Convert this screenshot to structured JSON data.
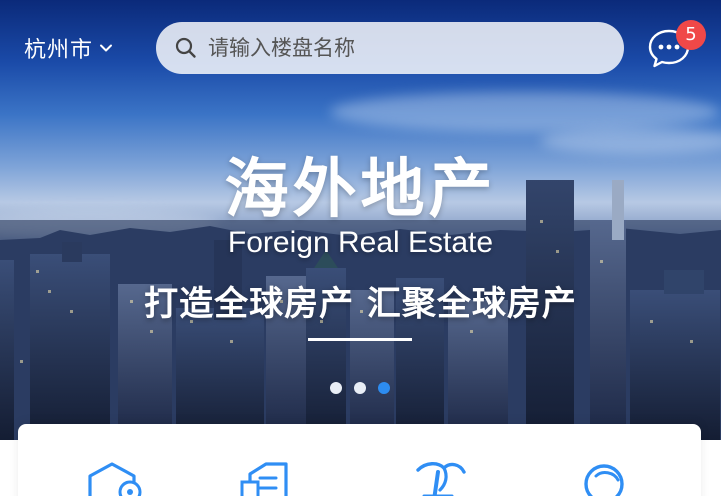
{
  "header": {
    "city": "杭州市",
    "search_placeholder": "请输入楼盘名称",
    "message_count": "5"
  },
  "banner": {
    "title": "海外地产",
    "subtitle_en": "Foreign Real Estate",
    "slogan": "打造全球房产  汇聚全球房产",
    "slide_count": 3,
    "active_slide": 3
  },
  "icons": {
    "city_dropdown": "chevron-down-icon",
    "search": "search-icon",
    "messages": "chat-bubble-icon",
    "categories": [
      "house-icon",
      "document-icon",
      "palm-tree-icon",
      "globe-icon"
    ]
  },
  "colors": {
    "accent": "#2d8cf0",
    "badge": "#f04848",
    "icon_blue": "#2f8ef4"
  }
}
